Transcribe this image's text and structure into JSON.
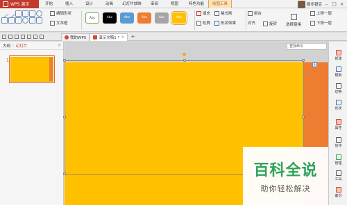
{
  "menubar": {
    "app_name": "WPS 演示",
    "items": [
      "开始",
      "插入",
      "设计",
      "动画",
      "幻灯片放映",
      "审阅",
      "视图",
      "特色功能",
      "绘图工具"
    ],
    "active_index": 8,
    "user": "极冬银豆",
    "window_controls": [
      "–",
      "□",
      "×"
    ]
  },
  "ribbon": {
    "edit_shape": "编辑形状",
    "textbox": "文本框",
    "style_label": "Abc",
    "styles": [
      {
        "bg": "#ffffff",
        "fg": "#333333",
        "border": "#70ad47"
      },
      {
        "bg": "#000000",
        "fg": "#ffffff",
        "border": "#000000"
      },
      {
        "bg": "#5b9bd5",
        "fg": "#ffffff",
        "border": "#5b9bd5"
      },
      {
        "bg": "#ed7d31",
        "fg": "#ffffff",
        "border": "#ed7d31"
      },
      {
        "bg": "#a5a5a5",
        "fg": "#ffffff",
        "border": "#a5a5a5"
      },
      {
        "bg": "#ffc000",
        "fg": "#ffffff",
        "border": "#ffc000"
      }
    ],
    "fill": "填充",
    "format_painter": "格式刷",
    "outline": "轮廓",
    "shape_effects": "形状效果",
    "combine": "组合",
    "align": "对齐",
    "rotate": "旋转",
    "selection_pane": "选择窗格",
    "bring_forward": "上移一层",
    "send_backward": "下移一层"
  },
  "tabbar": {
    "tabs": [
      {
        "label": "我的WPS",
        "active": false
      },
      {
        "label": "演示文稿1 *",
        "active": true
      }
    ],
    "add": "+",
    "close": "×"
  },
  "leftpane": {
    "tabs": [
      "大纲",
      "幻灯片"
    ],
    "active_tab": 1,
    "slide_number": "1",
    "close": "×"
  },
  "canvas": {
    "find_placeholder": "查找命令",
    "slide_color": "#ffc000",
    "accent_color": "#ed7d31"
  },
  "rightpanel": {
    "items": [
      "新建",
      "模板",
      "切换",
      "形状",
      "属性",
      "协作",
      "管理",
      "工具",
      "备份"
    ]
  },
  "watermark": {
    "title": "百科全说",
    "subtitle": "助你轻松解决"
  }
}
